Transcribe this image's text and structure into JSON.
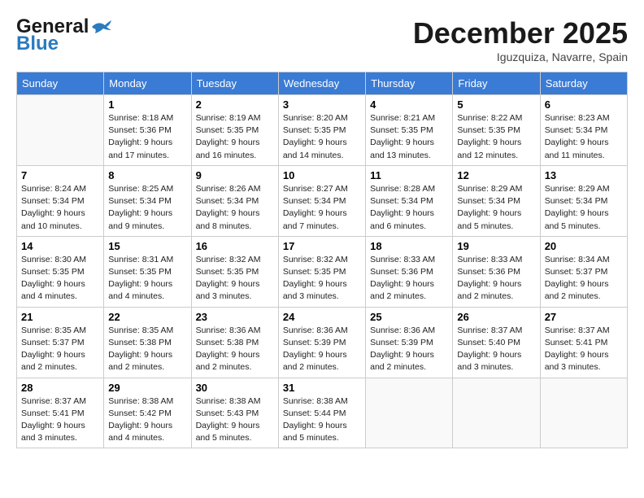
{
  "header": {
    "logo_line1": "General",
    "logo_line2": "Blue",
    "month": "December 2025",
    "location": "Iguzquiza, Navarre, Spain"
  },
  "days_of_week": [
    "Sunday",
    "Monday",
    "Tuesday",
    "Wednesday",
    "Thursday",
    "Friday",
    "Saturday"
  ],
  "weeks": [
    [
      {
        "day": "",
        "info": ""
      },
      {
        "day": "1",
        "info": "Sunrise: 8:18 AM\nSunset: 5:36 PM\nDaylight: 9 hours\nand 17 minutes."
      },
      {
        "day": "2",
        "info": "Sunrise: 8:19 AM\nSunset: 5:35 PM\nDaylight: 9 hours\nand 16 minutes."
      },
      {
        "day": "3",
        "info": "Sunrise: 8:20 AM\nSunset: 5:35 PM\nDaylight: 9 hours\nand 14 minutes."
      },
      {
        "day": "4",
        "info": "Sunrise: 8:21 AM\nSunset: 5:35 PM\nDaylight: 9 hours\nand 13 minutes."
      },
      {
        "day": "5",
        "info": "Sunrise: 8:22 AM\nSunset: 5:35 PM\nDaylight: 9 hours\nand 12 minutes."
      },
      {
        "day": "6",
        "info": "Sunrise: 8:23 AM\nSunset: 5:34 PM\nDaylight: 9 hours\nand 11 minutes."
      }
    ],
    [
      {
        "day": "7",
        "info": "Sunrise: 8:24 AM\nSunset: 5:34 PM\nDaylight: 9 hours\nand 10 minutes."
      },
      {
        "day": "8",
        "info": "Sunrise: 8:25 AM\nSunset: 5:34 PM\nDaylight: 9 hours\nand 9 minutes."
      },
      {
        "day": "9",
        "info": "Sunrise: 8:26 AM\nSunset: 5:34 PM\nDaylight: 9 hours\nand 8 minutes."
      },
      {
        "day": "10",
        "info": "Sunrise: 8:27 AM\nSunset: 5:34 PM\nDaylight: 9 hours\nand 7 minutes."
      },
      {
        "day": "11",
        "info": "Sunrise: 8:28 AM\nSunset: 5:34 PM\nDaylight: 9 hours\nand 6 minutes."
      },
      {
        "day": "12",
        "info": "Sunrise: 8:29 AM\nSunset: 5:34 PM\nDaylight: 9 hours\nand 5 minutes."
      },
      {
        "day": "13",
        "info": "Sunrise: 8:29 AM\nSunset: 5:34 PM\nDaylight: 9 hours\nand 5 minutes."
      }
    ],
    [
      {
        "day": "14",
        "info": "Sunrise: 8:30 AM\nSunset: 5:35 PM\nDaylight: 9 hours\nand 4 minutes."
      },
      {
        "day": "15",
        "info": "Sunrise: 8:31 AM\nSunset: 5:35 PM\nDaylight: 9 hours\nand 4 minutes."
      },
      {
        "day": "16",
        "info": "Sunrise: 8:32 AM\nSunset: 5:35 PM\nDaylight: 9 hours\nand 3 minutes."
      },
      {
        "day": "17",
        "info": "Sunrise: 8:32 AM\nSunset: 5:35 PM\nDaylight: 9 hours\nand 3 minutes."
      },
      {
        "day": "18",
        "info": "Sunrise: 8:33 AM\nSunset: 5:36 PM\nDaylight: 9 hours\nand 2 minutes."
      },
      {
        "day": "19",
        "info": "Sunrise: 8:33 AM\nSunset: 5:36 PM\nDaylight: 9 hours\nand 2 minutes."
      },
      {
        "day": "20",
        "info": "Sunrise: 8:34 AM\nSunset: 5:37 PM\nDaylight: 9 hours\nand 2 minutes."
      }
    ],
    [
      {
        "day": "21",
        "info": "Sunrise: 8:35 AM\nSunset: 5:37 PM\nDaylight: 9 hours\nand 2 minutes."
      },
      {
        "day": "22",
        "info": "Sunrise: 8:35 AM\nSunset: 5:38 PM\nDaylight: 9 hours\nand 2 minutes."
      },
      {
        "day": "23",
        "info": "Sunrise: 8:36 AM\nSunset: 5:38 PM\nDaylight: 9 hours\nand 2 minutes."
      },
      {
        "day": "24",
        "info": "Sunrise: 8:36 AM\nSunset: 5:39 PM\nDaylight: 9 hours\nand 2 minutes."
      },
      {
        "day": "25",
        "info": "Sunrise: 8:36 AM\nSunset: 5:39 PM\nDaylight: 9 hours\nand 2 minutes."
      },
      {
        "day": "26",
        "info": "Sunrise: 8:37 AM\nSunset: 5:40 PM\nDaylight: 9 hours\nand 3 minutes."
      },
      {
        "day": "27",
        "info": "Sunrise: 8:37 AM\nSunset: 5:41 PM\nDaylight: 9 hours\nand 3 minutes."
      }
    ],
    [
      {
        "day": "28",
        "info": "Sunrise: 8:37 AM\nSunset: 5:41 PM\nDaylight: 9 hours\nand 3 minutes."
      },
      {
        "day": "29",
        "info": "Sunrise: 8:38 AM\nSunset: 5:42 PM\nDaylight: 9 hours\nand 4 minutes."
      },
      {
        "day": "30",
        "info": "Sunrise: 8:38 AM\nSunset: 5:43 PM\nDaylight: 9 hours\nand 5 minutes."
      },
      {
        "day": "31",
        "info": "Sunrise: 8:38 AM\nSunset: 5:44 PM\nDaylight: 9 hours\nand 5 minutes."
      },
      {
        "day": "",
        "info": ""
      },
      {
        "day": "",
        "info": ""
      },
      {
        "day": "",
        "info": ""
      }
    ]
  ]
}
